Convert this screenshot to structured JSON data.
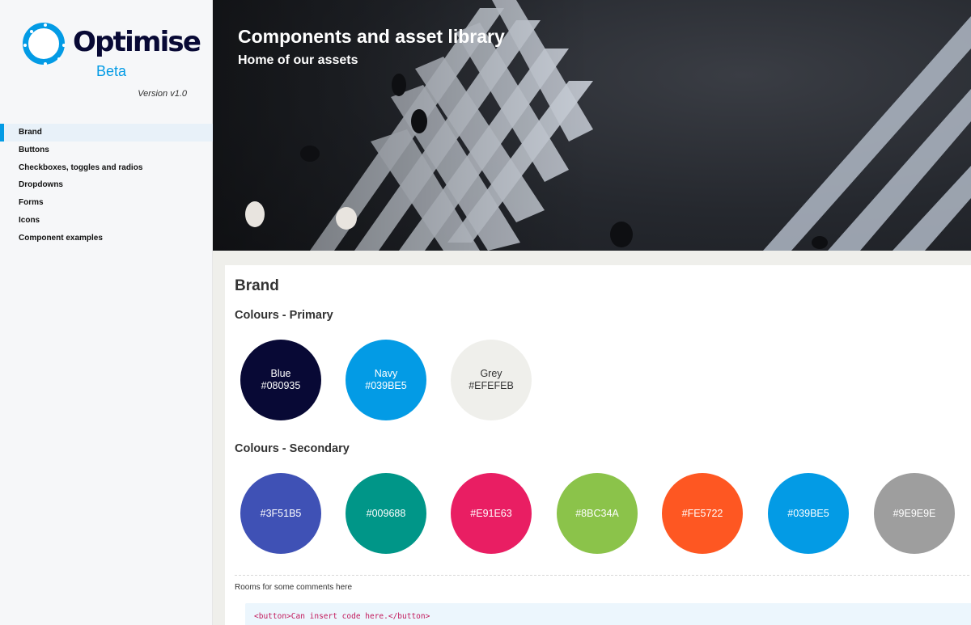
{
  "brand": {
    "name": "Optimise",
    "tag": "Beta",
    "version": "Version v1.0"
  },
  "sidebar": {
    "items": [
      {
        "label": "Brand",
        "active": true
      },
      {
        "label": "Buttons"
      },
      {
        "label": "Checkboxes, toggles and radios"
      },
      {
        "label": "Dropdowns"
      },
      {
        "label": "Forms"
      },
      {
        "label": "Icons"
      },
      {
        "label": "Component examples"
      }
    ]
  },
  "hero": {
    "title": "Components and asset library",
    "subtitle": "Home of our assets"
  },
  "section": {
    "title": "Brand",
    "primary_heading": "Colours - Primary",
    "primary": [
      {
        "name": "Blue",
        "hex": "#080935",
        "color": "#080935"
      },
      {
        "name": "Navy",
        "hex": "#039BE5",
        "color": "#039BE5"
      },
      {
        "name": "Grey",
        "hex": "#EFEFEB",
        "color": "#EFEFEB"
      }
    ],
    "secondary_heading": "Colours - Secondary",
    "secondary": [
      {
        "hex": "#3F51B5",
        "color": "#3F51B5"
      },
      {
        "hex": "#009688",
        "color": "#009688"
      },
      {
        "hex": "#E91E63",
        "color": "#E91E63"
      },
      {
        "hex": "#8BC34A",
        "color": "#8BC34A"
      },
      {
        "hex": "#FE5722",
        "color": "#FE5722"
      },
      {
        "hex": "#039BE5",
        "color": "#039BE5"
      },
      {
        "hex": "#9E9E9E",
        "color": "#9E9E9E"
      }
    ],
    "comment": "Rooms for some comments here",
    "code": "<button>Can insert code here.</button>"
  }
}
